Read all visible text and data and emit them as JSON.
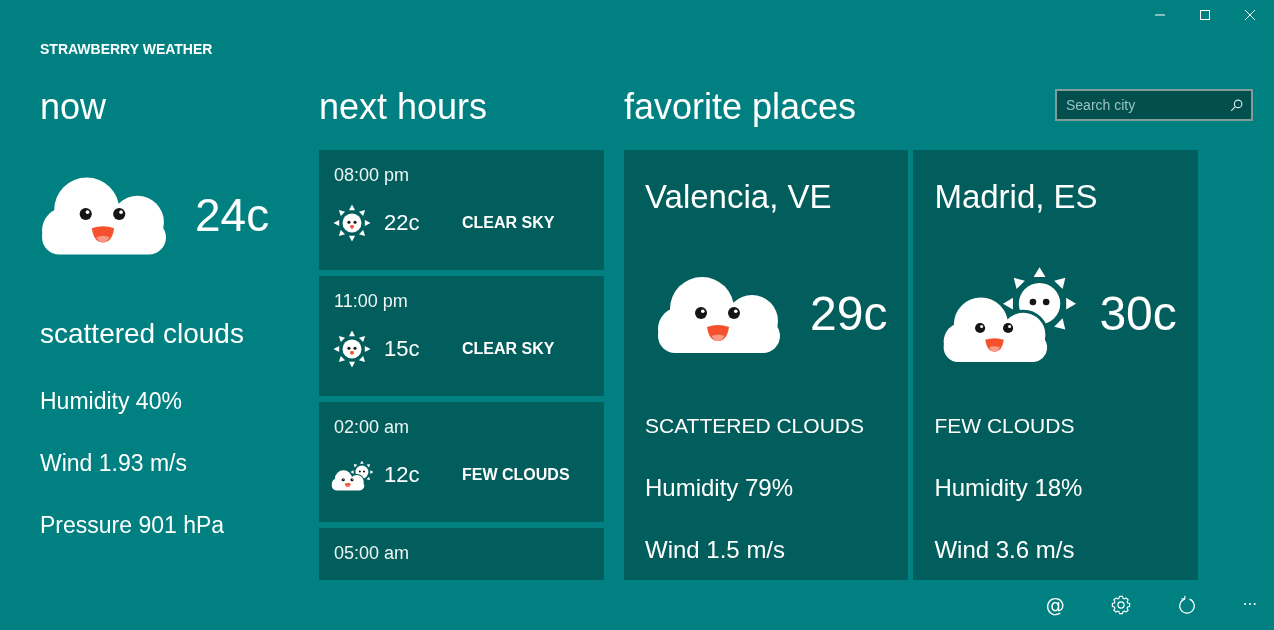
{
  "window": {
    "title": "STRAWBERRY WEATHER"
  },
  "now": {
    "heading": "now",
    "kind": "scattered_clouds",
    "temperature": "24c",
    "description": "scattered clouds",
    "details": [
      "Humidity 40%",
      "Wind 1.93 m/s",
      "Pressure 901 hPa"
    ]
  },
  "next_hours": {
    "heading": "next hours",
    "hours": [
      {
        "time": "08:00 pm",
        "kind": "clear_sky",
        "temperature": "22c",
        "description": "CLEAR SKY"
      },
      {
        "time": "11:00 pm",
        "kind": "clear_sky",
        "temperature": "15c",
        "description": "CLEAR SKY"
      },
      {
        "time": "02:00 am",
        "kind": "few_clouds",
        "temperature": "12c",
        "description": "FEW CLOUDS"
      },
      {
        "time": "05:00 am"
      }
    ]
  },
  "favorite_places": {
    "heading": "favorite places",
    "search": {
      "placeholder": "Search city"
    },
    "places": [
      {
        "name": "Valencia, VE",
        "kind": "scattered_clouds",
        "temperature": "29c",
        "description": "SCATTERED CLOUDS",
        "humidity": "Humidity 79%",
        "wind": "Wind 1.5 m/s"
      },
      {
        "name": "Madrid, ES",
        "kind": "few_clouds",
        "temperature": "30c",
        "description": "FEW CLOUDS",
        "humidity": "Humidity 18%",
        "wind": "Wind 3.6 m/s"
      }
    ]
  },
  "app_bar": {
    "buttons": [
      {
        "kind": "mention",
        "label": "@"
      },
      {
        "kind": "settings"
      },
      {
        "kind": "refresh"
      },
      {
        "kind": "more",
        "label": "···"
      }
    ]
  }
}
